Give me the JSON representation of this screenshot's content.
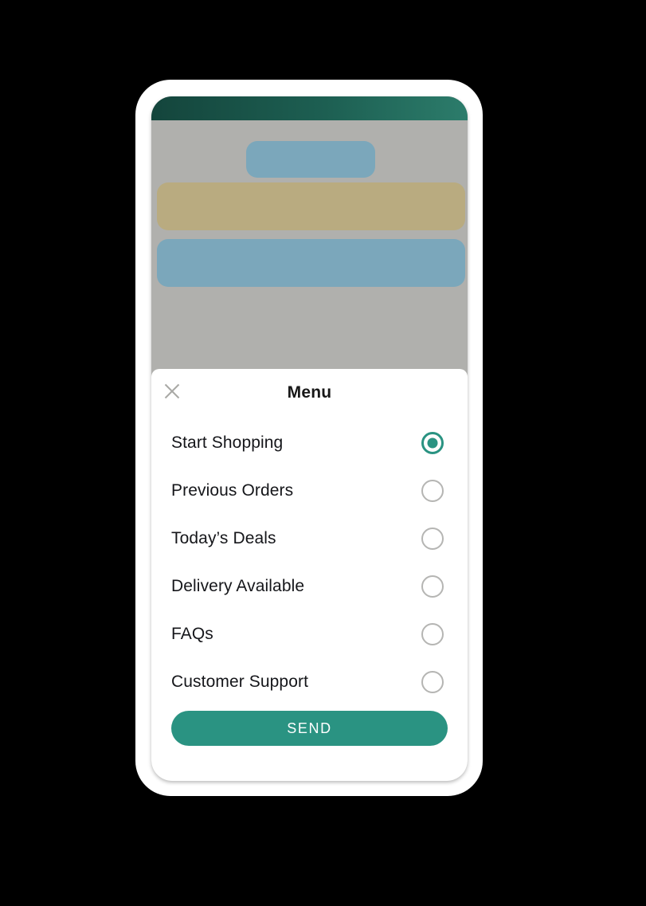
{
  "device": {
    "frame_color": "#ffffff",
    "screen_bg": "#b0b0ad"
  },
  "app": {
    "header": {
      "gradient_from": "#14453c",
      "gradient_to": "#2c7c6b"
    },
    "skeleton": [
      {
        "name": "pill",
        "color": "#7ba7bb"
      },
      {
        "name": "bar-tan",
        "color": "#b9ab80"
      },
      {
        "name": "bar-blue",
        "color": "#7ba7bb"
      }
    ]
  },
  "menu_sheet": {
    "title": "Menu",
    "close_icon": "close-icon",
    "accent_color": "#2a9382",
    "inactive_radio_color": "#b5b5b3",
    "options": [
      {
        "label": "Start Shopping",
        "selected": true
      },
      {
        "label": "Previous Orders",
        "selected": false
      },
      {
        "label": "Today’s Deals",
        "selected": false
      },
      {
        "label": "Delivery Available",
        "selected": false
      },
      {
        "label": "FAQs",
        "selected": false
      },
      {
        "label": "Customer Support",
        "selected": false
      }
    ],
    "send_label": "SEND"
  }
}
